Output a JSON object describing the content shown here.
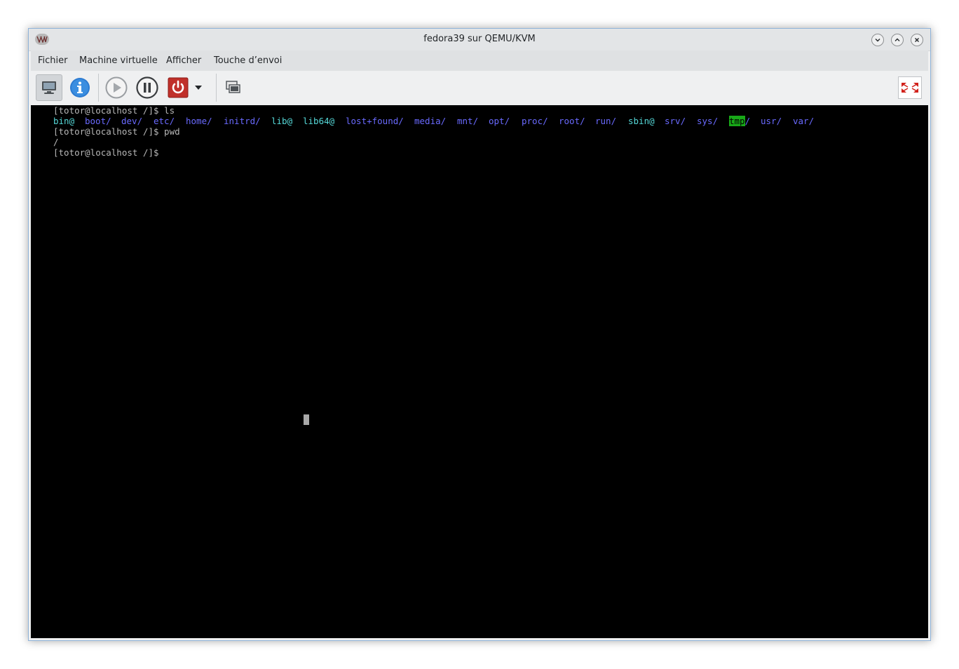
{
  "window": {
    "title": "fedora39 sur QEMU/KVM",
    "app_icon": "virt-manager-icon",
    "controls": [
      "minimize-icon",
      "maximize-icon",
      "close-icon"
    ]
  },
  "menubar": {
    "items": [
      "Fichier",
      "Machine virtuelle",
      "Afficher",
      "Touche d’envoi"
    ]
  },
  "toolbar": {
    "buttons": [
      "console-icon",
      "details-info-icon",
      "run-icon",
      "pause-icon",
      "shutdown-icon",
      "shutdown-dropdown-icon",
      "snapshots-icon",
      "fullscreen-icon"
    ]
  },
  "terminal": {
    "line1": "[totor@localhost /]$ ls",
    "ls_entries": [
      {
        "text": "bin@",
        "color": "#55d8d8"
      },
      {
        "text": "boot/",
        "color": "#6a6aff"
      },
      {
        "text": "dev/",
        "color": "#6a6aff"
      },
      {
        "text": "etc/",
        "color": "#6a6aff"
      },
      {
        "text": "home/",
        "color": "#6a6aff"
      },
      {
        "text": "initrd/",
        "color": "#6a6aff"
      },
      {
        "text": "lib@",
        "color": "#55d8d8"
      },
      {
        "text": "lib64@",
        "color": "#55d8d8"
      },
      {
        "text": "lost+found/",
        "color": "#6a6aff"
      },
      {
        "text": "media/",
        "color": "#6a6aff"
      },
      {
        "text": "mnt/",
        "color": "#6a6aff"
      },
      {
        "text": "opt/",
        "color": "#6a6aff"
      },
      {
        "text": "proc/",
        "color": "#6a6aff"
      },
      {
        "text": "root/",
        "color": "#6a6aff"
      },
      {
        "text": "run/",
        "color": "#6a6aff"
      },
      {
        "text": "sbin@",
        "color": "#55d8d8"
      },
      {
        "text": "srv/",
        "color": "#6a6aff"
      },
      {
        "text": "sys/",
        "color": "#6a6aff"
      },
      {
        "text": "tmp",
        "color": "#000000",
        "highlight": "#18a818",
        "suffix": "/"
      },
      {
        "text": "usr/",
        "color": "#6a6aff"
      },
      {
        "text": "var/",
        "color": "#6a6aff"
      }
    ],
    "line3": "[totor@localhost /]$ pwd",
    "line4": "/",
    "line5": "[totor@localhost /]$"
  }
}
